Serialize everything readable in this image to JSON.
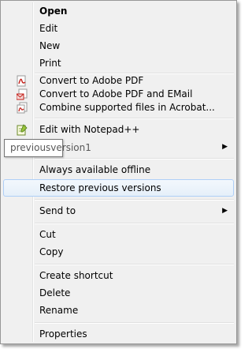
{
  "menu": {
    "open": "Open",
    "edit": "Edit",
    "new": "New",
    "print": "Print",
    "convert_pdf": "Convert to Adobe PDF",
    "convert_pdf_email": "Convert to Adobe PDF and EMail",
    "combine_acrobat": "Combine supported files in Acrobat...",
    "edit_notepad": "Edit with Notepad++",
    "always_offline": "Always available offline",
    "restore_versions": "Restore previous versions",
    "send_to": "Send to",
    "cut": "Cut",
    "copy": "Copy",
    "create_shortcut": "Create shortcut",
    "delete": "Delete",
    "rename": "Rename",
    "properties": "Properties",
    "submenu_arrow": "▶"
  },
  "tooltip": {
    "text": "previousversion1"
  },
  "colors": {
    "menu_bg": "#f0f0f0",
    "hover_border": "#aecff7",
    "pdf_red": "#c4201a"
  }
}
